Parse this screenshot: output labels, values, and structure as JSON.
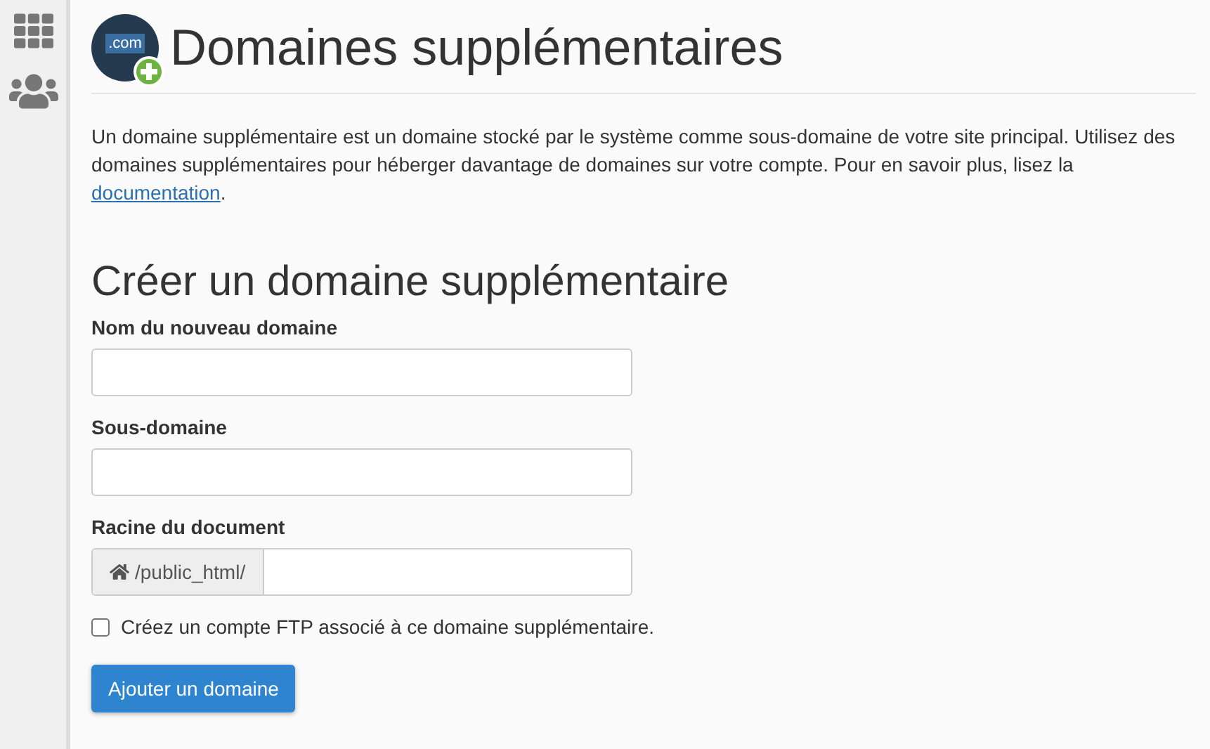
{
  "sidebar": {
    "items": [
      {
        "kind": "apps"
      },
      {
        "kind": "users"
      }
    ]
  },
  "header": {
    "logo_text": ".com",
    "title": "Domaines supplémentaires"
  },
  "description": {
    "text": "Un domaine supplémentaire est un domaine stocké par le système comme sous-domaine de votre site principal. Utilisez des domaines supplémentaires pour héberger davantage de domaines sur votre compte. Pour en savoir plus, lisez la",
    "link": "documentation",
    "end": "."
  },
  "form": {
    "heading": "Créer un domaine supplémentaire",
    "fields": [
      {
        "label": "Nom du nouveau domaine",
        "kind": "text"
      },
      {
        "label": "Sous-domaine",
        "kind": "text"
      },
      {
        "label": "Racine du document",
        "kind": "prefixed",
        "prefix": "/public_html/"
      }
    ],
    "checkbox": {
      "label": "Créez un compte FTP associé à ce domaine supplémentaire.",
      "checked": false
    },
    "submit": "Ajouter un domaine"
  }
}
